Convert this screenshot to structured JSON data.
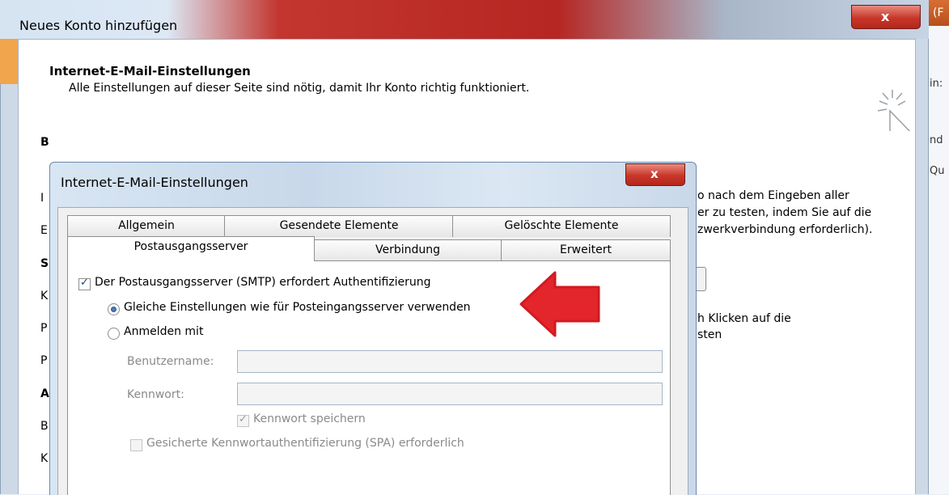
{
  "outer": {
    "title": "Neues Konto hinzufügen",
    "close_glyph": "x",
    "header_title": "Internet-E-Mail-Einstellungen",
    "header_subtitle": "Alle Einstellungen auf dieser Seite sind nötig, damit Ihr Konto richtig funktioniert.",
    "header_icon": "sparkle-cursor-icon",
    "right_fragments": [
      "o nach dem Eingeben aller",
      "er zu testen, indem Sie auf die",
      "zwerkverbindung erforderlich).",
      "h Klicken auf die",
      "sten"
    ],
    "left_fragments": [
      "B",
      "I",
      "E",
      "S",
      "K",
      "P",
      "P",
      "A",
      "B",
      "K"
    ]
  },
  "background_window": {
    "title_fragment": "(F",
    "fragments": [
      "in:",
      "nd",
      "Qu"
    ]
  },
  "dialog": {
    "title": "Internet-E-Mail-Einstellungen",
    "close_glyph": "x",
    "tabs_row1": [
      "Allgemein",
      "Gesendete Elemente",
      "Gelöschte Elemente"
    ],
    "tabs_row2": [
      "Postausgangsserver",
      "Verbindung",
      "Erweitert"
    ],
    "active_tab": "Postausgangsserver",
    "smtp_auth": {
      "label": "Der Postausgangsserver (SMTP) erfordert Authentifizierung",
      "checked": true
    },
    "options": [
      {
        "label": "Gleiche Einstellungen wie für Posteingangsserver verwenden",
        "selected": true
      },
      {
        "label": "Anmelden mit",
        "selected": false
      }
    ],
    "username_label": "Benutzername:",
    "username_value": "",
    "password_label": "Kennwort:",
    "password_value": "",
    "save_password": {
      "label": "Kennwort speichern",
      "checked": true
    },
    "spa": {
      "label": "Gesicherte Kennwortauthentifizierung (SPA) erforderlich",
      "checked": false
    }
  },
  "colors": {
    "annotation_arrow": "#e3262b",
    "close_button": "#c8362a"
  }
}
